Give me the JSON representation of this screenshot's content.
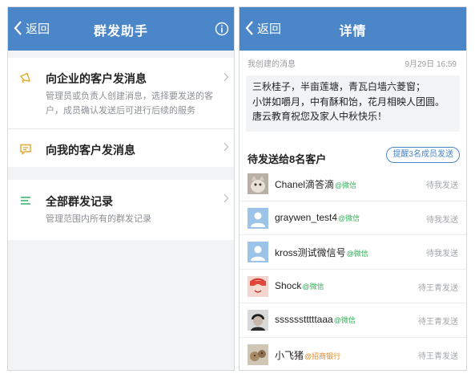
{
  "left": {
    "nav": {
      "back_label": "返回",
      "title": "群发助手"
    },
    "items": [
      {
        "title": "向企业的客户发消息",
        "desc": "管理员或负责人创建消息，选择要发送的客户，成员确认发送后可进行后续的服务"
      },
      {
        "title": "向我的客户发消息",
        "desc": ""
      },
      {
        "title": "全部群发记录",
        "desc": "管理范围内所有的群发记录"
      }
    ],
    "icon_colors": {
      "megaphone": "#e3a82b",
      "chat": "#e3a82b",
      "list": "#2fb463"
    }
  },
  "right": {
    "nav": {
      "back_label": "返回",
      "title": "详情"
    },
    "meta": {
      "label": "我创建的消息",
      "time": "9月29日 16:59"
    },
    "message": [
      "三秋桂子，半亩莲塘，青瓦白墙六菱窗；",
      "小饼如嚼月，中有酥和饴，花月相映人团圆。",
      "唐云教育祝您及家人中秋快乐！"
    ],
    "pending_title": "待发送给8名客户",
    "remind_button": "提醒3名成员发送",
    "recipients": [
      {
        "name": "Chanel滴答滴",
        "tag": "@微信",
        "state": "待我发送",
        "avatar": "photo-cat"
      },
      {
        "name": "graywen_test4",
        "tag": "@微信",
        "state": "待我发送",
        "avatar": "default"
      },
      {
        "name": "kross测试微信号",
        "tag": "@微信",
        "state": "待我发送",
        "avatar": "default"
      },
      {
        "name": "Shock",
        "tag": "@微信",
        "state": "待王青发送",
        "avatar": "photo-red"
      },
      {
        "name": "sssssstttttaaa",
        "tag": "@微信",
        "state": "待王青发送",
        "avatar": "photo-dark"
      },
      {
        "name": "小飞猪",
        "tag": "@招商银行",
        "state": "待王青发送",
        "avatar": "photo-bear"
      }
    ]
  },
  "colors": {
    "nav": "#4a86c8",
    "wechat_tag": "#34b15a",
    "org_tag": "#e08a25"
  }
}
